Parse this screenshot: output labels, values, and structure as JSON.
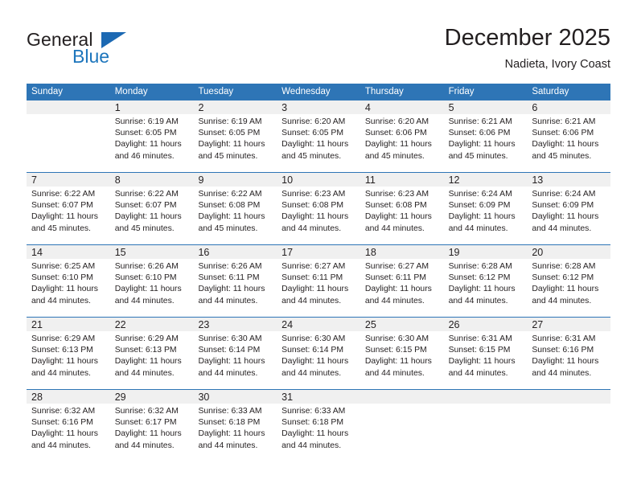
{
  "logo": {
    "general": "General",
    "blue": "Blue",
    "triangle_color": "#1c69b3",
    "blue_color": "#1c75bc"
  },
  "header": {
    "title": "December 2025",
    "subtitle": "Nadieta, Ivory Coast"
  },
  "theme": {
    "header_bg": "#2e75b6",
    "daynum_band": "#f0f0f0",
    "text": "#231f20"
  },
  "weekdays": [
    "Sunday",
    "Monday",
    "Tuesday",
    "Wednesday",
    "Thursday",
    "Friday",
    "Saturday"
  ],
  "weeks": [
    [
      {
        "day": "",
        "lines": []
      },
      {
        "day": "1",
        "lines": [
          "Sunrise: 6:19 AM",
          "Sunset: 6:05 PM",
          "Daylight: 11 hours",
          "and 46 minutes."
        ]
      },
      {
        "day": "2",
        "lines": [
          "Sunrise: 6:19 AM",
          "Sunset: 6:05 PM",
          "Daylight: 11 hours",
          "and 45 minutes."
        ]
      },
      {
        "day": "3",
        "lines": [
          "Sunrise: 6:20 AM",
          "Sunset: 6:05 PM",
          "Daylight: 11 hours",
          "and 45 minutes."
        ]
      },
      {
        "day": "4",
        "lines": [
          "Sunrise: 6:20 AM",
          "Sunset: 6:06 PM",
          "Daylight: 11 hours",
          "and 45 minutes."
        ]
      },
      {
        "day": "5",
        "lines": [
          "Sunrise: 6:21 AM",
          "Sunset: 6:06 PM",
          "Daylight: 11 hours",
          "and 45 minutes."
        ]
      },
      {
        "day": "6",
        "lines": [
          "Sunrise: 6:21 AM",
          "Sunset: 6:06 PM",
          "Daylight: 11 hours",
          "and 45 minutes."
        ]
      }
    ],
    [
      {
        "day": "7",
        "lines": [
          "Sunrise: 6:22 AM",
          "Sunset: 6:07 PM",
          "Daylight: 11 hours",
          "and 45 minutes."
        ]
      },
      {
        "day": "8",
        "lines": [
          "Sunrise: 6:22 AM",
          "Sunset: 6:07 PM",
          "Daylight: 11 hours",
          "and 45 minutes."
        ]
      },
      {
        "day": "9",
        "lines": [
          "Sunrise: 6:22 AM",
          "Sunset: 6:08 PM",
          "Daylight: 11 hours",
          "and 45 minutes."
        ]
      },
      {
        "day": "10",
        "lines": [
          "Sunrise: 6:23 AM",
          "Sunset: 6:08 PM",
          "Daylight: 11 hours",
          "and 44 minutes."
        ]
      },
      {
        "day": "11",
        "lines": [
          "Sunrise: 6:23 AM",
          "Sunset: 6:08 PM",
          "Daylight: 11 hours",
          "and 44 minutes."
        ]
      },
      {
        "day": "12",
        "lines": [
          "Sunrise: 6:24 AM",
          "Sunset: 6:09 PM",
          "Daylight: 11 hours",
          "and 44 minutes."
        ]
      },
      {
        "day": "13",
        "lines": [
          "Sunrise: 6:24 AM",
          "Sunset: 6:09 PM",
          "Daylight: 11 hours",
          "and 44 minutes."
        ]
      }
    ],
    [
      {
        "day": "14",
        "lines": [
          "Sunrise: 6:25 AM",
          "Sunset: 6:10 PM",
          "Daylight: 11 hours",
          "and 44 minutes."
        ]
      },
      {
        "day": "15",
        "lines": [
          "Sunrise: 6:26 AM",
          "Sunset: 6:10 PM",
          "Daylight: 11 hours",
          "and 44 minutes."
        ]
      },
      {
        "day": "16",
        "lines": [
          "Sunrise: 6:26 AM",
          "Sunset: 6:11 PM",
          "Daylight: 11 hours",
          "and 44 minutes."
        ]
      },
      {
        "day": "17",
        "lines": [
          "Sunrise: 6:27 AM",
          "Sunset: 6:11 PM",
          "Daylight: 11 hours",
          "and 44 minutes."
        ]
      },
      {
        "day": "18",
        "lines": [
          "Sunrise: 6:27 AM",
          "Sunset: 6:11 PM",
          "Daylight: 11 hours",
          "and 44 minutes."
        ]
      },
      {
        "day": "19",
        "lines": [
          "Sunrise: 6:28 AM",
          "Sunset: 6:12 PM",
          "Daylight: 11 hours",
          "and 44 minutes."
        ]
      },
      {
        "day": "20",
        "lines": [
          "Sunrise: 6:28 AM",
          "Sunset: 6:12 PM",
          "Daylight: 11 hours",
          "and 44 minutes."
        ]
      }
    ],
    [
      {
        "day": "21",
        "lines": [
          "Sunrise: 6:29 AM",
          "Sunset: 6:13 PM",
          "Daylight: 11 hours",
          "and 44 minutes."
        ]
      },
      {
        "day": "22",
        "lines": [
          "Sunrise: 6:29 AM",
          "Sunset: 6:13 PM",
          "Daylight: 11 hours",
          "and 44 minutes."
        ]
      },
      {
        "day": "23",
        "lines": [
          "Sunrise: 6:30 AM",
          "Sunset: 6:14 PM",
          "Daylight: 11 hours",
          "and 44 minutes."
        ]
      },
      {
        "day": "24",
        "lines": [
          "Sunrise: 6:30 AM",
          "Sunset: 6:14 PM",
          "Daylight: 11 hours",
          "and 44 minutes."
        ]
      },
      {
        "day": "25",
        "lines": [
          "Sunrise: 6:30 AM",
          "Sunset: 6:15 PM",
          "Daylight: 11 hours",
          "and 44 minutes."
        ]
      },
      {
        "day": "26",
        "lines": [
          "Sunrise: 6:31 AM",
          "Sunset: 6:15 PM",
          "Daylight: 11 hours",
          "and 44 minutes."
        ]
      },
      {
        "day": "27",
        "lines": [
          "Sunrise: 6:31 AM",
          "Sunset: 6:16 PM",
          "Daylight: 11 hours",
          "and 44 minutes."
        ]
      }
    ],
    [
      {
        "day": "28",
        "lines": [
          "Sunrise: 6:32 AM",
          "Sunset: 6:16 PM",
          "Daylight: 11 hours",
          "and 44 minutes."
        ]
      },
      {
        "day": "29",
        "lines": [
          "Sunrise: 6:32 AM",
          "Sunset: 6:17 PM",
          "Daylight: 11 hours",
          "and 44 minutes."
        ]
      },
      {
        "day": "30",
        "lines": [
          "Sunrise: 6:33 AM",
          "Sunset: 6:18 PM",
          "Daylight: 11 hours",
          "and 44 minutes."
        ]
      },
      {
        "day": "31",
        "lines": [
          "Sunrise: 6:33 AM",
          "Sunset: 6:18 PM",
          "Daylight: 11 hours",
          "and 44 minutes."
        ]
      },
      {
        "day": "",
        "lines": []
      },
      {
        "day": "",
        "lines": []
      },
      {
        "day": "",
        "lines": []
      }
    ]
  ]
}
